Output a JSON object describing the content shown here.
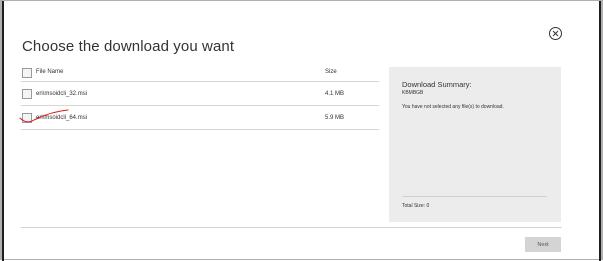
{
  "dialog": {
    "title": "Choose the download you want"
  },
  "table": {
    "headers": {
      "name": "File Name",
      "size": "Size"
    },
    "rows": [
      {
        "name": "en\\msoidcli_32.msi",
        "size": "4.1 MB",
        "checked": false
      },
      {
        "name": "en\\msoidcli_64.msi",
        "size": "5.9 MB",
        "checked": false
      }
    ]
  },
  "summary": {
    "title": "Download Summary:",
    "id": "KBMBGB",
    "message": "You have not selected any file(s) to download.",
    "total": "Total Size: 0"
  },
  "footer": {
    "next_label": "Next"
  },
  "colors": {
    "panel_bg": "#ececec",
    "button_bg": "#d4d4d4",
    "annotation_red": "#d42020"
  },
  "icons": {
    "close": "close-circle-icon"
  }
}
